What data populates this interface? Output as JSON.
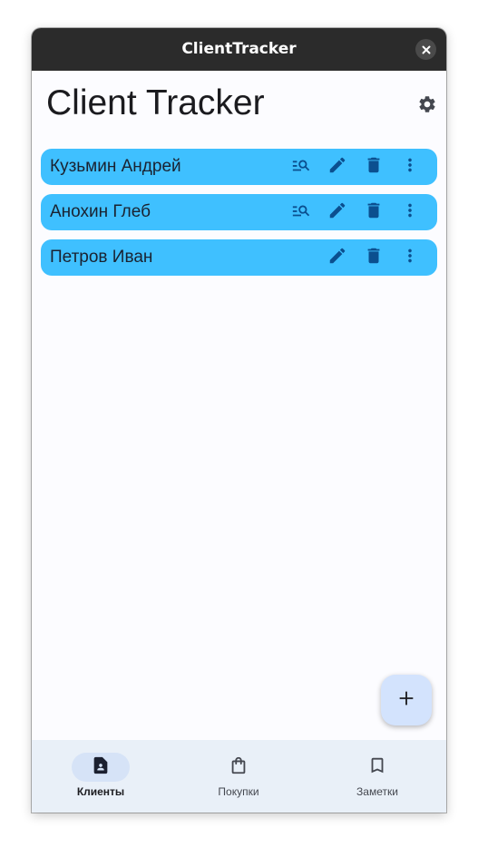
{
  "window": {
    "title": "ClientTracker"
  },
  "header": {
    "title": "Client Tracker"
  },
  "clients": [
    {
      "name": "Кузьмин Андрей",
      "has_details": true
    },
    {
      "name": "Анохин Глеб",
      "has_details": true
    },
    {
      "name": "Петров Иван",
      "has_details": false
    }
  ],
  "icons": {
    "close": "close-icon",
    "settings": "gear-icon",
    "details": "manage-search-icon",
    "edit": "pencil-icon",
    "delete": "trash-icon",
    "more": "more-vert-icon",
    "add": "plus-icon",
    "clients_nav": "contact-page-icon",
    "purchases_nav": "shopping-bag-icon",
    "notes_nav": "bookmark-icon"
  },
  "bottom_nav": {
    "items": [
      {
        "label": "Клиенты",
        "active": true
      },
      {
        "label": "Покупки",
        "active": false
      },
      {
        "label": "Заметки",
        "active": false
      }
    ]
  },
  "colors": {
    "row_background": "#3fc0ff",
    "row_icon": "#0b4f8f",
    "fab_background": "#d3e3fd",
    "nav_background": "#e9f0f8",
    "active_indicator": "#d6e3f7",
    "titlebar": "#2b2b2b"
  }
}
